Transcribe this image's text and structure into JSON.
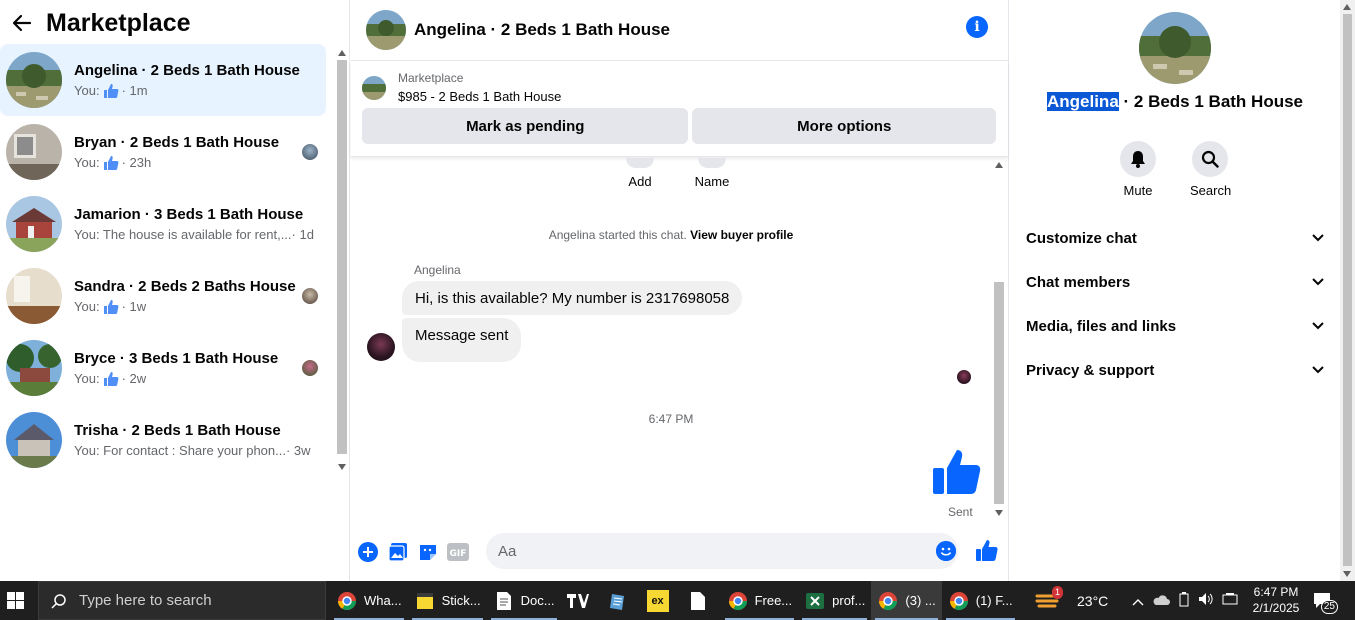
{
  "left": {
    "title": "Marketplace",
    "conversations": [
      {
        "name": "Angelina · 2 Beds 1 Bath House",
        "prefix": "You:",
        "preview": "",
        "time": "· 1m",
        "liked": true,
        "active": true
      },
      {
        "name": "Bryan · 2 Beds 1 Bath House",
        "prefix": "You:",
        "preview": "",
        "time": "· 23h",
        "liked": true
      },
      {
        "name": "Jamarion · 3 Beds 1 Bath House",
        "prefix": "",
        "preview": "You: The house is available for rent,...",
        "time": "· 1d",
        "liked": false
      },
      {
        "name": "Sandra · 2 Beds 2 Baths House",
        "prefix": "You:",
        "preview": "",
        "time": "· 1w",
        "liked": true
      },
      {
        "name": "Bryce · 3 Beds 1 Bath House",
        "prefix": "You:",
        "preview": "",
        "time": "· 2w",
        "liked": true
      },
      {
        "name": "Trisha · 2 Beds 1 Bath House",
        "prefix": "",
        "preview": "You: For contact : Share your phon...",
        "time": "· 3w",
        "liked": false
      }
    ]
  },
  "chat": {
    "title": "Angelina · 2 Beds 1 Bath House",
    "listing_category": "Marketplace",
    "listing_price": "$985 - 2 Beds 1 Bath House",
    "mark_pending": "Mark as pending",
    "more_options": "More options",
    "quick_add": "Add",
    "quick_name": "Name",
    "system_note": "Angelina started this chat.",
    "view_profile": "View buyer profile",
    "sender": "Angelina",
    "msg1": "Hi, is this available? My number is 2317698058",
    "msg2": "Message sent",
    "time": "6:47 PM",
    "sent": "Sent",
    "input_placeholder": "Aa"
  },
  "right": {
    "name_highlight": "Angelina",
    "name_rest": " · 2 Beds 1 Bath House",
    "mute": "Mute",
    "search": "Search",
    "menu": [
      "Customize chat",
      "Chat members",
      "Media, files and links",
      "Privacy & support"
    ]
  },
  "taskbar": {
    "search_placeholder": "Type here to search",
    "apps": [
      {
        "label": "Wha...",
        "icon": "chrome-icon"
      },
      {
        "label": "Stick...",
        "icon": "sticky-notes-icon"
      },
      {
        "label": "Doc...",
        "icon": "document-icon"
      },
      {
        "label": "",
        "icon": "tradingview-icon"
      },
      {
        "label": "",
        "icon": "notepad-icon"
      },
      {
        "label": "",
        "icon": "exness-icon"
      },
      {
        "label": "",
        "icon": "file-icon"
      },
      {
        "label": "Free...",
        "icon": "chrome-icon"
      },
      {
        "label": "prof...",
        "icon": "excel-icon"
      },
      {
        "label": "(3) ...",
        "icon": "chrome-icon"
      },
      {
        "label": "(1) F...",
        "icon": "chrome-icon"
      }
    ],
    "weather": "23°C",
    "weather_badge": "1",
    "time": "6:47 PM",
    "date": "2/1/2025",
    "notifications": "25"
  },
  "colors": {
    "accent": "#0866ff",
    "active_bg": "#e7f3ff",
    "highlight": "#0a58d6"
  }
}
